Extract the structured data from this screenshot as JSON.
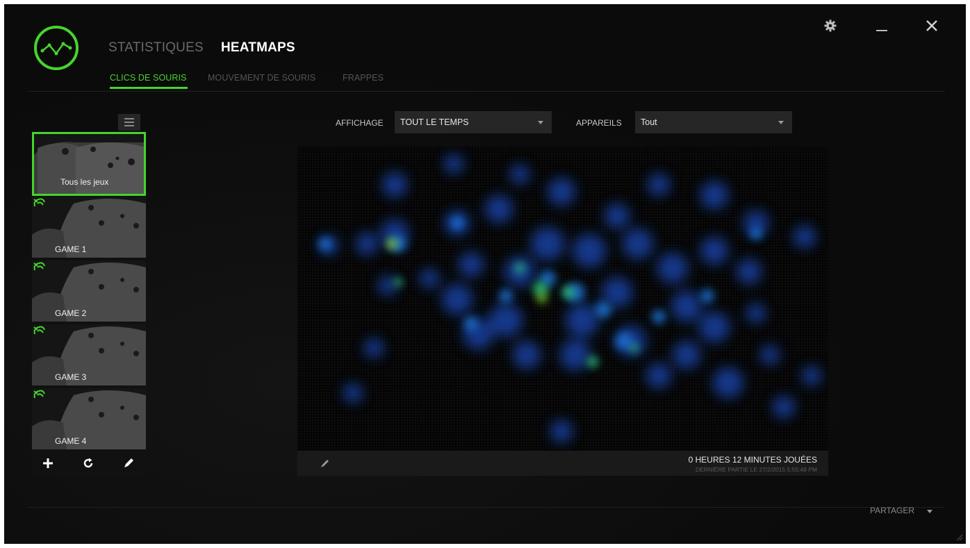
{
  "nav": {
    "tabs": [
      {
        "label": "STATISTIQUES",
        "active": false
      },
      {
        "label": "HEATMAPS",
        "active": true
      }
    ],
    "subtabs": [
      {
        "label": "CLICS DE SOURIS",
        "active": true
      },
      {
        "label": "MOUVEMENT DE SOURIS",
        "active": false
      },
      {
        "label": "FRAPPES",
        "active": false
      }
    ]
  },
  "window": {
    "settings_icon": "gear-icon",
    "minimize_icon": "minimize-icon",
    "close_icon": "close-icon"
  },
  "sidebar": {
    "menu_icon": "hamburger-icon",
    "games": [
      {
        "label": "Tous les jeux",
        "selected": true,
        "icon": "gamepad-thumbnail"
      },
      {
        "label": "GAME 1",
        "selected": false,
        "icon": "razer-snake-icon"
      },
      {
        "label": "GAME 2",
        "selected": false,
        "icon": "razer-snake-icon"
      },
      {
        "label": "GAME 3",
        "selected": false,
        "icon": "razer-snake-icon"
      },
      {
        "label": "GAME 4",
        "selected": false,
        "icon": "razer-snake-icon"
      }
    ],
    "actions": [
      "plus-icon",
      "refresh-icon",
      "pencil-icon"
    ]
  },
  "filters": {
    "display_label": "AFFICHAGE",
    "display_value": "TOUT LE TEMPS",
    "devices_label": "APPAREILS",
    "devices_value": "Tout"
  },
  "stats": {
    "played": "0 HEURES 12 MINUTES JOUÉES",
    "last_game": "DERNIÈRE PARTIE LE 27/2/2015 5:55:48 PM"
  },
  "footer": {
    "share_label": "PARTAGER"
  },
  "colors": {
    "accent": "#44d62c",
    "background": "#0d0d0d",
    "panel": "#262626"
  }
}
